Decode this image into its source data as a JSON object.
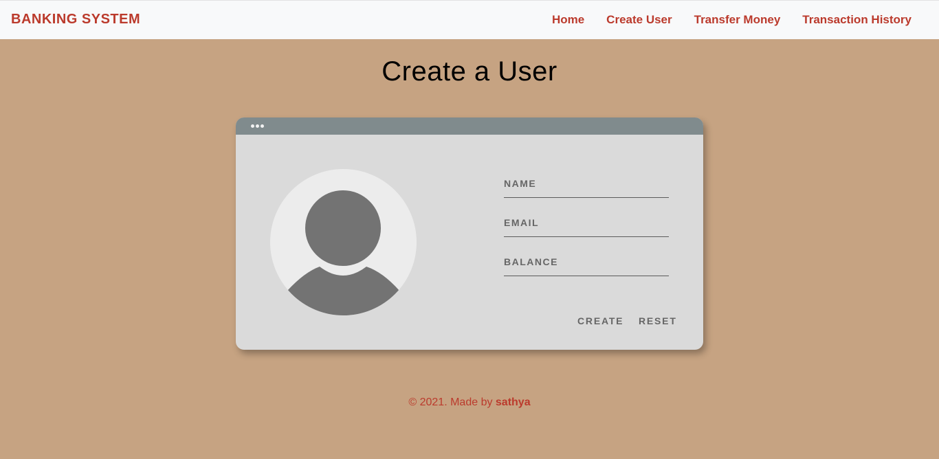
{
  "navbar": {
    "brand": "BANKING SYSTEM",
    "links": [
      {
        "label": "Home"
      },
      {
        "label": "Create User"
      },
      {
        "label": "Transfer Money"
      },
      {
        "label": "Transaction History"
      }
    ]
  },
  "page": {
    "title": "Create a User"
  },
  "form": {
    "name_placeholder": "NAME",
    "email_placeholder": "EMAIL",
    "balance_placeholder": "BALANCE",
    "create_label": "CREATE",
    "reset_label": "RESET"
  },
  "footer": {
    "prefix": "© 2021. Made by ",
    "author": "sathya"
  },
  "colors": {
    "brand": "#bb3a2c",
    "background": "#c6a382",
    "card": "#dadada",
    "card_bar": "#808b8d",
    "avatar_fill": "#737373",
    "avatar_bg": "#ececec"
  },
  "icons": {
    "avatar": "user-avatar-icon",
    "window_dots": "more-dots-icon"
  }
}
